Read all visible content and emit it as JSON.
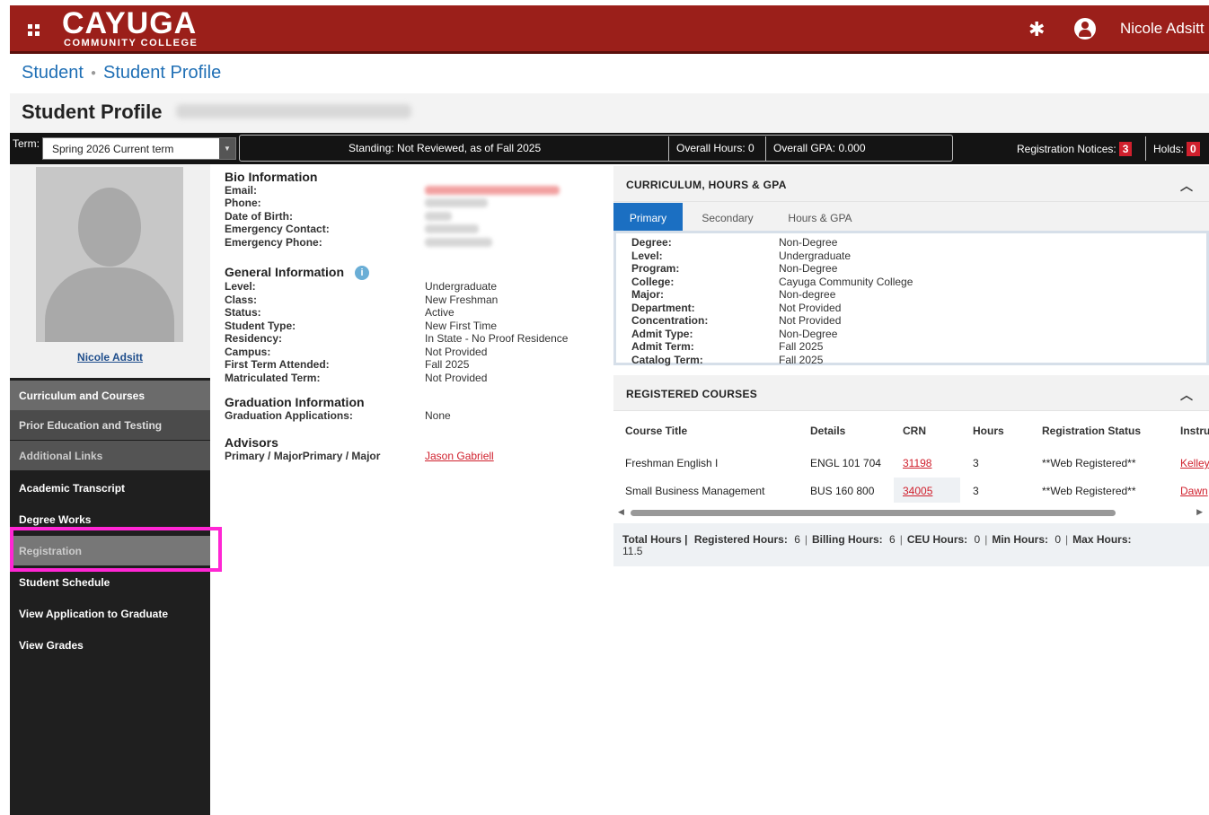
{
  "header": {
    "logo_main": "CAYUGA",
    "logo_sub": "COMMUNITY COLLEGE",
    "user_name": "Nicole Adsitt"
  },
  "breadcrumb": {
    "items": [
      "Student",
      "Student Profile"
    ]
  },
  "page_title": "Student Profile",
  "status_bar": {
    "term_label": "Term:",
    "term_value": "Spring 2026 Current term",
    "standing": "Standing: Not Reviewed, as of Fall 2025",
    "overall_hours": "Overall Hours: 0",
    "overall_gpa": "Overall GPA: 0.000",
    "notices_label": "Registration Notices:",
    "notices_count": "3",
    "holds_label": "Holds:",
    "holds_count": "0"
  },
  "sidebar": {
    "student_name": "Nicole Adsitt",
    "items": [
      "Curriculum and Courses",
      "Prior Education and Testing",
      "Additional Links",
      "Academic Transcript",
      "Degree Works",
      "Registration",
      "Student Schedule",
      "View Application to Graduate",
      "View Grades"
    ]
  },
  "bio": {
    "title": "Bio Information",
    "labels": [
      "Email:",
      "Phone:",
      "Date of Birth:",
      "Emergency Contact:",
      "Emergency Phone:"
    ]
  },
  "general": {
    "title": "General Information",
    "rows": [
      {
        "k": "Level:",
        "v": "Undergraduate"
      },
      {
        "k": "Class:",
        "v": "New Freshman"
      },
      {
        "k": "Status:",
        "v": "Active"
      },
      {
        "k": "Student Type:",
        "v": "New First Time"
      },
      {
        "k": "Residency:",
        "v": "In State - No Proof Residence"
      },
      {
        "k": "Campus:",
        "v": "Not Provided"
      },
      {
        "k": "First Term Attended:",
        "v": "Fall 2025"
      },
      {
        "k": "Matriculated Term:",
        "v": "Not Provided"
      }
    ]
  },
  "graduation": {
    "title": "Graduation Information",
    "label": "Graduation Applications:",
    "value": "None"
  },
  "advisors": {
    "title": "Advisors",
    "label": "Primary / MajorPrimary / Major",
    "value": "Jason Gabriell"
  },
  "curriculum": {
    "title": "CURRICULUM, HOURS & GPA",
    "tabs": [
      "Primary",
      "Secondary",
      "Hours & GPA"
    ],
    "rows": [
      {
        "k": "Degree:",
        "v": "Non-Degree"
      },
      {
        "k": "Level:",
        "v": "Undergraduate"
      },
      {
        "k": "Program:",
        "v": "Non-Degree"
      },
      {
        "k": "College:",
        "v": "Cayuga Community College"
      },
      {
        "k": "Major:",
        "v": "Non-degree"
      },
      {
        "k": "Department:",
        "v": "Not Provided"
      },
      {
        "k": "Concentration:",
        "v": "Not Provided"
      },
      {
        "k": "Admit Type:",
        "v": "Non-Degree"
      },
      {
        "k": "Admit Term:",
        "v": "Fall 2025"
      },
      {
        "k": "Catalog Term:",
        "v": "Fall 2025"
      }
    ]
  },
  "registered": {
    "title": "REGISTERED COURSES",
    "columns": [
      "Course Title",
      "Details",
      "CRN",
      "Hours",
      "Registration Status",
      "Instru"
    ],
    "rows": [
      {
        "title": "Freshman English I",
        "details": "ENGL 101 704",
        "crn": "31198",
        "hours": "3",
        "status": "**Web Registered**",
        "instructor": "Kelley"
      },
      {
        "title": "Small Business Management",
        "details": "BUS 160 800",
        "crn": "34005",
        "hours": "3",
        "status": "**Web Registered**",
        "instructor": "Dawn"
      }
    ],
    "totals": {
      "total_label": "Total Hours |",
      "registered_label": "Registered Hours:",
      "registered": "6",
      "billing_label": "Billing Hours:",
      "billing": "6",
      "ceu_label": "CEU Hours:",
      "ceu": "0",
      "min_label": "Min Hours:",
      "min": "0",
      "max_label": "Max Hours:",
      "max": "11.5"
    }
  }
}
